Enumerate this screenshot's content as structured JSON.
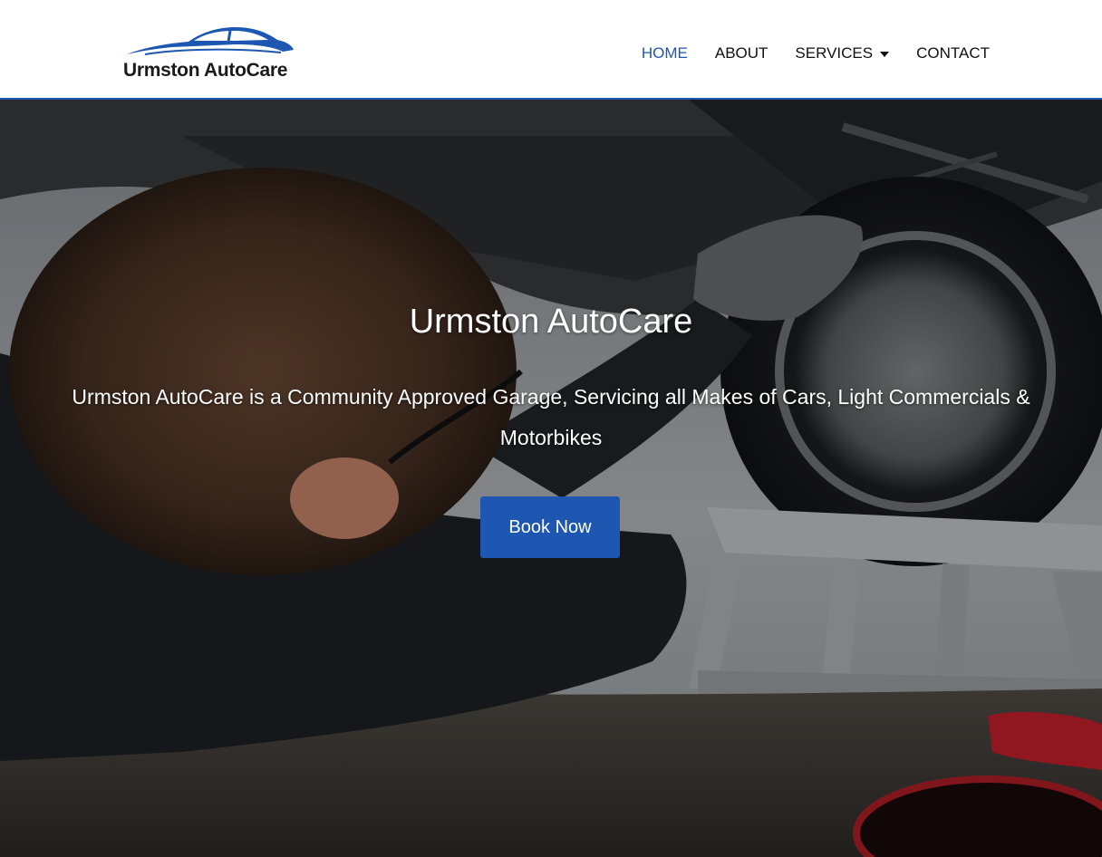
{
  "brand": {
    "name": "Urmston AutoCare",
    "logo_icon": "car-silhouette-icon",
    "logo_color": "#1d57b2"
  },
  "nav": {
    "items": [
      {
        "label": "HOME",
        "active": true
      },
      {
        "label": "ABOUT",
        "active": false
      },
      {
        "label": "SERVICES",
        "active": false,
        "dropdown": true
      },
      {
        "label": "CONTACT",
        "active": false
      }
    ]
  },
  "hero": {
    "title": "Urmston AutoCare",
    "subtitle": "Urmston AutoCare is a Community Approved Garage, Servicing all Makes of Cars, Light Commercials & Motorbikes",
    "cta_label": "Book Now",
    "background": "mechanic-under-car-photo"
  },
  "colors": {
    "accent": "#1d57b2",
    "nav_text": "#111111",
    "hero_text": "#ffffff"
  }
}
